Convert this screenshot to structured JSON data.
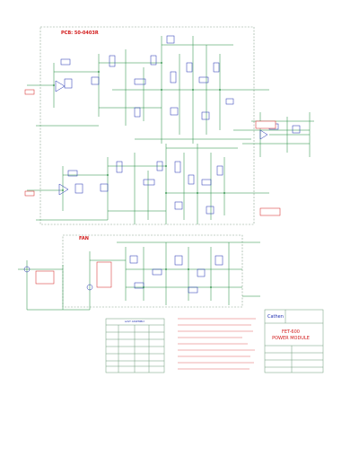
{
  "drawing": {
    "pcb_label": "PCB: 50-0403R",
    "fan_label": "FAN",
    "brand": "Cathen",
    "model": "FET-600",
    "title": "POWER MODULE"
  },
  "table": {
    "header": "LAST ASSEMBLY"
  },
  "colors": {
    "wire": "#1f8a3c",
    "component": "#1e2fb0",
    "label": "#d21b1b",
    "border": "#6d9a78"
  }
}
